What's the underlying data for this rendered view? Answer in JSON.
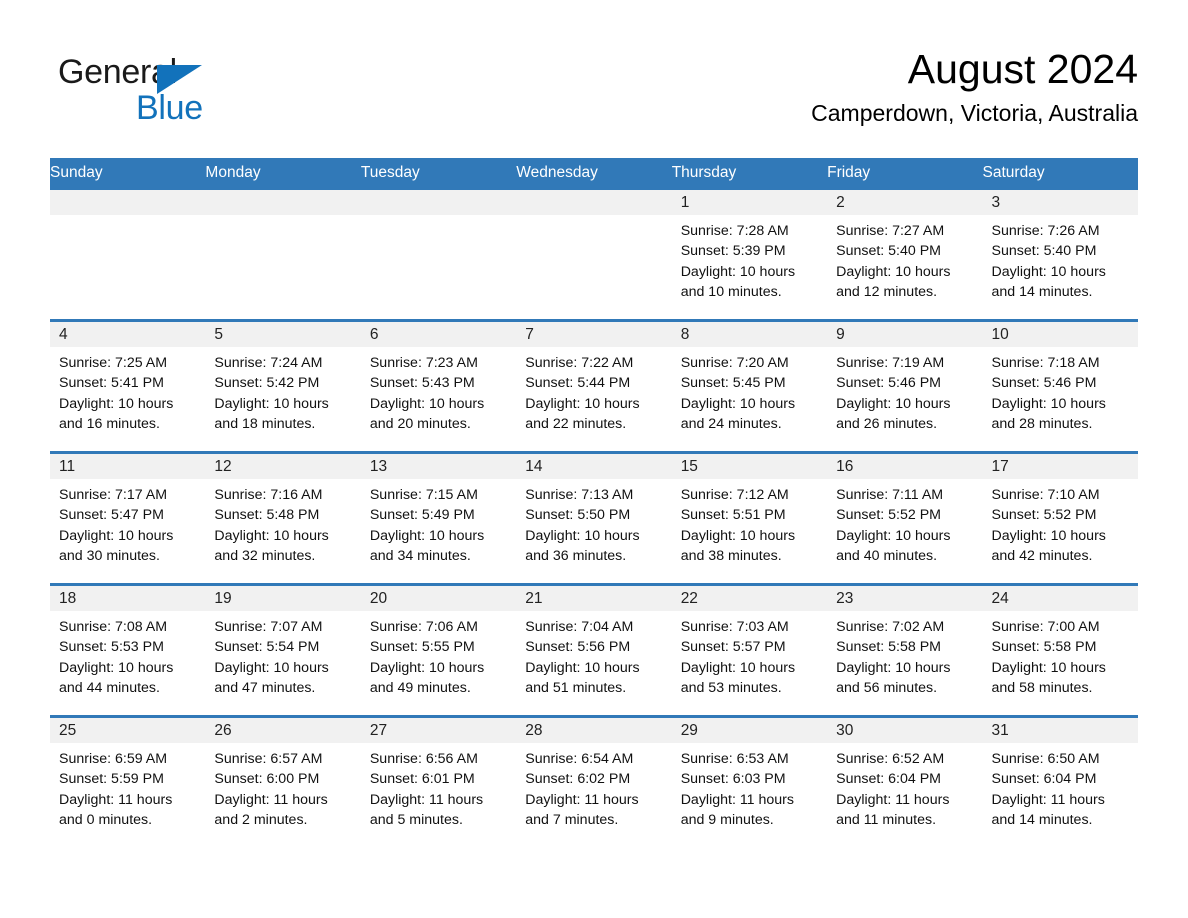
{
  "brand": {
    "name_part1": "General",
    "name_part2": "Blue",
    "triangle_icon": "blue-triangle-logo-mark",
    "accent_color": "#1272bb"
  },
  "header": {
    "title": "August 2024",
    "subtitle": "Camperdown, Victoria, Australia"
  },
  "theme": {
    "header_blue": "#3179b8",
    "daynum_band_gray": "#f1f1f1",
    "page_background": "#ffffff"
  },
  "weekday_headers": [
    "Sunday",
    "Monday",
    "Tuesday",
    "Wednesday",
    "Thursday",
    "Friday",
    "Saturday"
  ],
  "weeks": [
    [
      {
        "day": "",
        "lines": []
      },
      {
        "day": "",
        "lines": []
      },
      {
        "day": "",
        "lines": []
      },
      {
        "day": "",
        "lines": []
      },
      {
        "day": "1",
        "lines": [
          "Sunrise: 7:28 AM",
          "Sunset: 5:39 PM",
          "Daylight: 10 hours",
          "and 10 minutes."
        ]
      },
      {
        "day": "2",
        "lines": [
          "Sunrise: 7:27 AM",
          "Sunset: 5:40 PM",
          "Daylight: 10 hours",
          "and 12 minutes."
        ]
      },
      {
        "day": "3",
        "lines": [
          "Sunrise: 7:26 AM",
          "Sunset: 5:40 PM",
          "Daylight: 10 hours",
          "and 14 minutes."
        ]
      }
    ],
    [
      {
        "day": "4",
        "lines": [
          "Sunrise: 7:25 AM",
          "Sunset: 5:41 PM",
          "Daylight: 10 hours",
          "and 16 minutes."
        ]
      },
      {
        "day": "5",
        "lines": [
          "Sunrise: 7:24 AM",
          "Sunset: 5:42 PM",
          "Daylight: 10 hours",
          "and 18 minutes."
        ]
      },
      {
        "day": "6",
        "lines": [
          "Sunrise: 7:23 AM",
          "Sunset: 5:43 PM",
          "Daylight: 10 hours",
          "and 20 minutes."
        ]
      },
      {
        "day": "7",
        "lines": [
          "Sunrise: 7:22 AM",
          "Sunset: 5:44 PM",
          "Daylight: 10 hours",
          "and 22 minutes."
        ]
      },
      {
        "day": "8",
        "lines": [
          "Sunrise: 7:20 AM",
          "Sunset: 5:45 PM",
          "Daylight: 10 hours",
          "and 24 minutes."
        ]
      },
      {
        "day": "9",
        "lines": [
          "Sunrise: 7:19 AM",
          "Sunset: 5:46 PM",
          "Daylight: 10 hours",
          "and 26 minutes."
        ]
      },
      {
        "day": "10",
        "lines": [
          "Sunrise: 7:18 AM",
          "Sunset: 5:46 PM",
          "Daylight: 10 hours",
          "and 28 minutes."
        ]
      }
    ],
    [
      {
        "day": "11",
        "lines": [
          "Sunrise: 7:17 AM",
          "Sunset: 5:47 PM",
          "Daylight: 10 hours",
          "and 30 minutes."
        ]
      },
      {
        "day": "12",
        "lines": [
          "Sunrise: 7:16 AM",
          "Sunset: 5:48 PM",
          "Daylight: 10 hours",
          "and 32 minutes."
        ]
      },
      {
        "day": "13",
        "lines": [
          "Sunrise: 7:15 AM",
          "Sunset: 5:49 PM",
          "Daylight: 10 hours",
          "and 34 minutes."
        ]
      },
      {
        "day": "14",
        "lines": [
          "Sunrise: 7:13 AM",
          "Sunset: 5:50 PM",
          "Daylight: 10 hours",
          "and 36 minutes."
        ]
      },
      {
        "day": "15",
        "lines": [
          "Sunrise: 7:12 AM",
          "Sunset: 5:51 PM",
          "Daylight: 10 hours",
          "and 38 minutes."
        ]
      },
      {
        "day": "16",
        "lines": [
          "Sunrise: 7:11 AM",
          "Sunset: 5:52 PM",
          "Daylight: 10 hours",
          "and 40 minutes."
        ]
      },
      {
        "day": "17",
        "lines": [
          "Sunrise: 7:10 AM",
          "Sunset: 5:52 PM",
          "Daylight: 10 hours",
          "and 42 minutes."
        ]
      }
    ],
    [
      {
        "day": "18",
        "lines": [
          "Sunrise: 7:08 AM",
          "Sunset: 5:53 PM",
          "Daylight: 10 hours",
          "and 44 minutes."
        ]
      },
      {
        "day": "19",
        "lines": [
          "Sunrise: 7:07 AM",
          "Sunset: 5:54 PM",
          "Daylight: 10 hours",
          "and 47 minutes."
        ]
      },
      {
        "day": "20",
        "lines": [
          "Sunrise: 7:06 AM",
          "Sunset: 5:55 PM",
          "Daylight: 10 hours",
          "and 49 minutes."
        ]
      },
      {
        "day": "21",
        "lines": [
          "Sunrise: 7:04 AM",
          "Sunset: 5:56 PM",
          "Daylight: 10 hours",
          "and 51 minutes."
        ]
      },
      {
        "day": "22",
        "lines": [
          "Sunrise: 7:03 AM",
          "Sunset: 5:57 PM",
          "Daylight: 10 hours",
          "and 53 minutes."
        ]
      },
      {
        "day": "23",
        "lines": [
          "Sunrise: 7:02 AM",
          "Sunset: 5:58 PM",
          "Daylight: 10 hours",
          "and 56 minutes."
        ]
      },
      {
        "day": "24",
        "lines": [
          "Sunrise: 7:00 AM",
          "Sunset: 5:58 PM",
          "Daylight: 10 hours",
          "and 58 minutes."
        ]
      }
    ],
    [
      {
        "day": "25",
        "lines": [
          "Sunrise: 6:59 AM",
          "Sunset: 5:59 PM",
          "Daylight: 11 hours",
          "and 0 minutes."
        ]
      },
      {
        "day": "26",
        "lines": [
          "Sunrise: 6:57 AM",
          "Sunset: 6:00 PM",
          "Daylight: 11 hours",
          "and 2 minutes."
        ]
      },
      {
        "day": "27",
        "lines": [
          "Sunrise: 6:56 AM",
          "Sunset: 6:01 PM",
          "Daylight: 11 hours",
          "and 5 minutes."
        ]
      },
      {
        "day": "28",
        "lines": [
          "Sunrise: 6:54 AM",
          "Sunset: 6:02 PM",
          "Daylight: 11 hours",
          "and 7 minutes."
        ]
      },
      {
        "day": "29",
        "lines": [
          "Sunrise: 6:53 AM",
          "Sunset: 6:03 PM",
          "Daylight: 11 hours",
          "and 9 minutes."
        ]
      },
      {
        "day": "30",
        "lines": [
          "Sunrise: 6:52 AM",
          "Sunset: 6:04 PM",
          "Daylight: 11 hours",
          "and 11 minutes."
        ]
      },
      {
        "day": "31",
        "lines": [
          "Sunrise: 6:50 AM",
          "Sunset: 6:04 PM",
          "Daylight: 11 hours",
          "and 14 minutes."
        ]
      }
    ]
  ]
}
